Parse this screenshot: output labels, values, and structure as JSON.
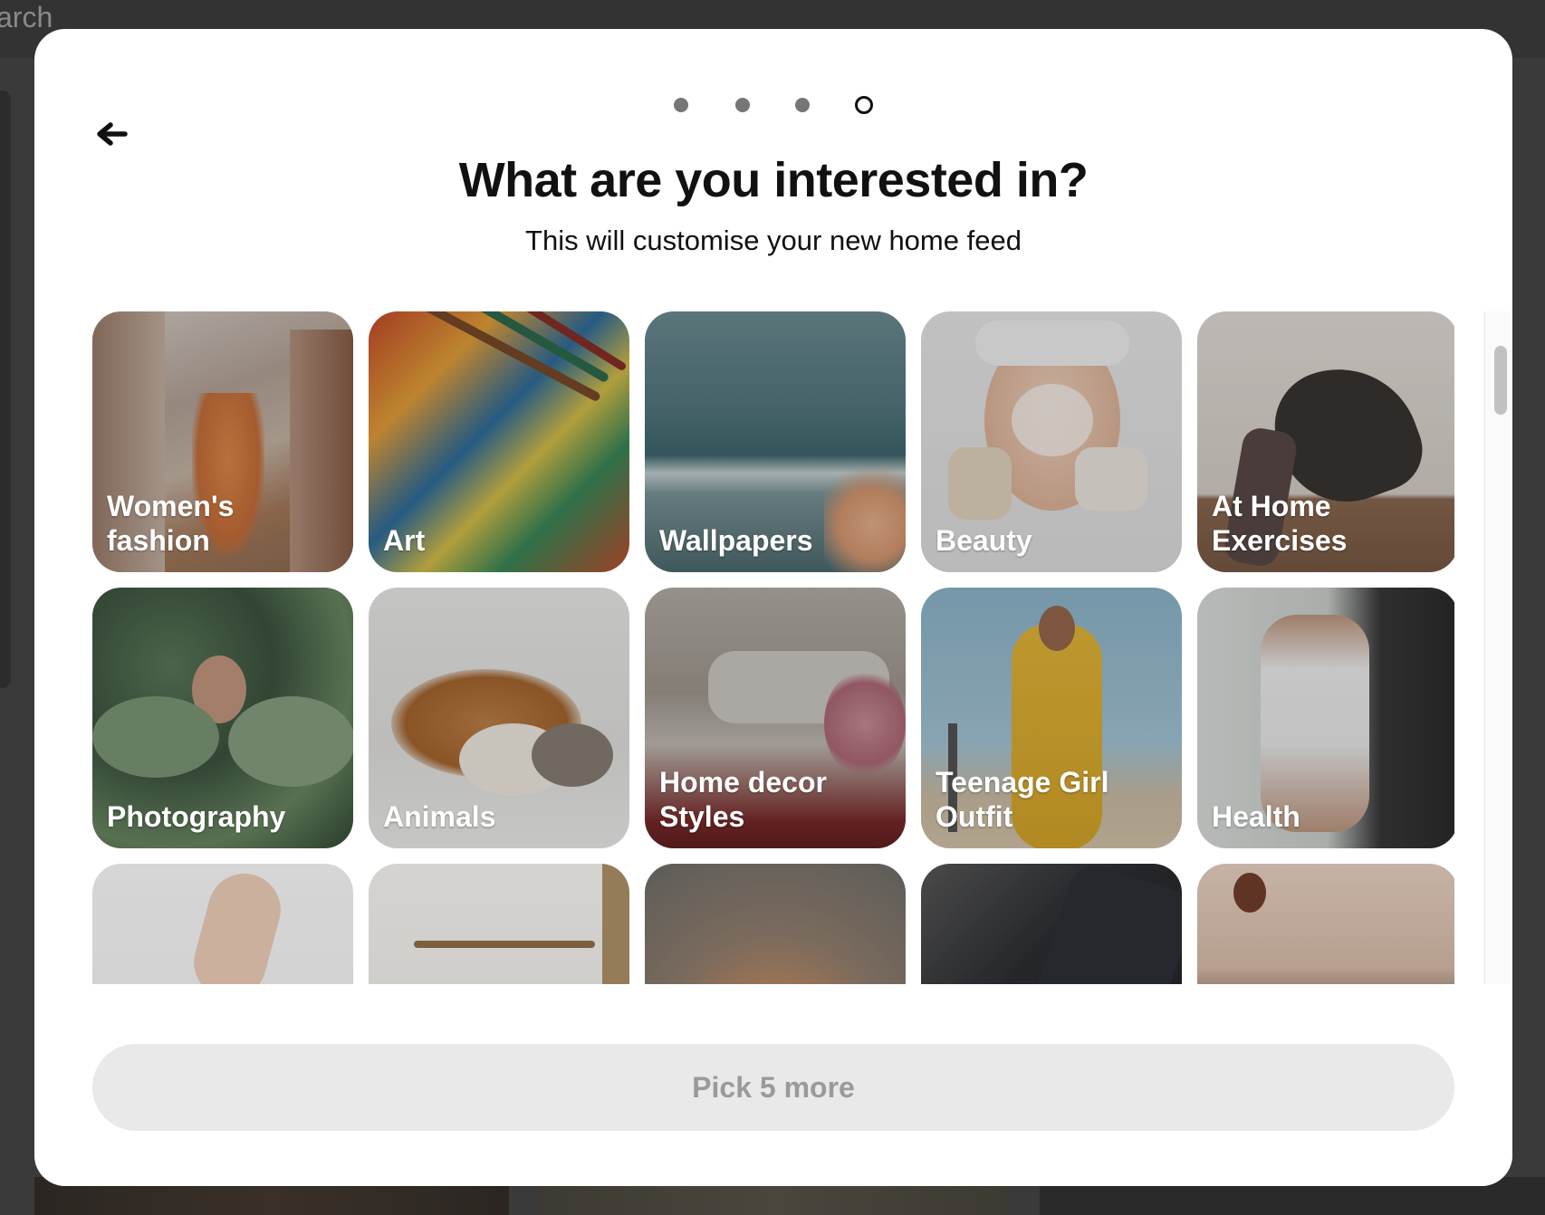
{
  "background": {
    "search_text": "arch"
  },
  "modal": {
    "progress": {
      "total_steps": 4,
      "current_step": 4
    },
    "back_icon": "arrow-left-icon",
    "title": "What are you interested in?",
    "subtitle": "This will customise your new home feed",
    "topics": [
      {
        "label": "Women's fashion",
        "image": "woman in orange dress on city street"
      },
      {
        "label": "Art",
        "image": "paint brushes on colorful palette"
      },
      {
        "label": "Wallpapers",
        "image": "ocean waves with blossoms"
      },
      {
        "label": "Beauty",
        "image": "woman with face mask holding jars"
      },
      {
        "label": "At Home Exercises",
        "image": "woman doing yoga backbend"
      },
      {
        "label": "Photography",
        "image": "woman among lotus leaves"
      },
      {
        "label": "Animals",
        "image": "puppies and kitten sleeping in bed"
      },
      {
        "label": "Home decor Styles",
        "image": "bedroom with fur pillows"
      },
      {
        "label": "Teenage Girl Outfit",
        "image": "woman in yellow tracksuit"
      },
      {
        "label": "Health",
        "image": "woman running on treadmill"
      },
      {
        "label": "",
        "image": "hand with bracelet"
      },
      {
        "label": "",
        "image": "driftwood wall hanging"
      },
      {
        "label": "",
        "image": "orange kitten"
      },
      {
        "label": "",
        "image": "black phones"
      },
      {
        "label": "",
        "image": "hot air balloon over temples"
      }
    ],
    "cta_label": "Pick 5 more"
  }
}
